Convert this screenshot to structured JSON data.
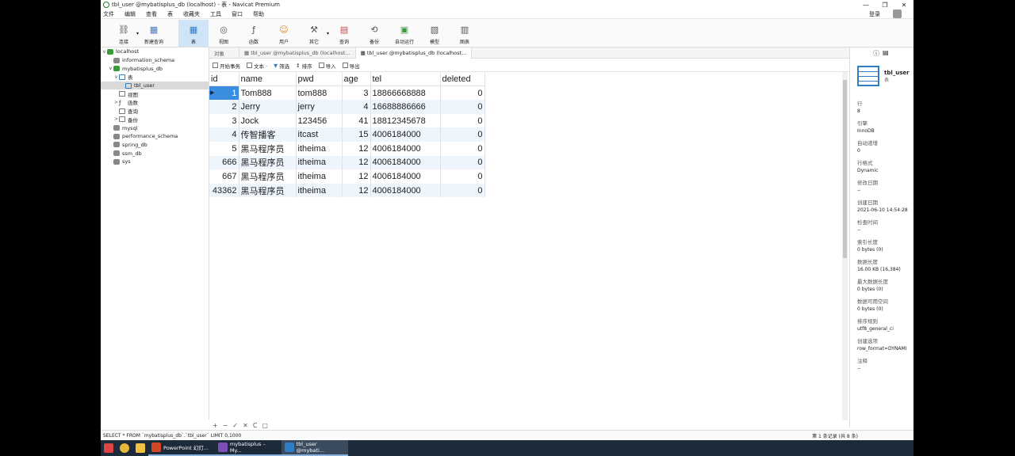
{
  "window": {
    "title": "tbl_user @mybatisplus_db (localhost) - 表 - Navicat Premium",
    "min": "—",
    "max": "❐",
    "close": "✕"
  },
  "menu": [
    "文件",
    "编辑",
    "查看",
    "表",
    "收藏夹",
    "工具",
    "窗口",
    "帮助"
  ],
  "login": "登录",
  "toolbar": [
    {
      "label": "连接",
      "icon": "⛓"
    },
    {
      "label": "新建查询",
      "icon": "▦"
    },
    {
      "label": "表",
      "icon": "▦"
    },
    {
      "label": "视图",
      "icon": "◎"
    },
    {
      "label": "函数",
      "icon": "ƒ"
    },
    {
      "label": "用户",
      "icon": "☺"
    },
    {
      "label": "其它",
      "icon": "⚒"
    },
    {
      "label": "查询",
      "icon": "▤"
    },
    {
      "label": "备份",
      "icon": "⟲"
    },
    {
      "label": "自动运行",
      "icon": "▣"
    },
    {
      "label": "模型",
      "icon": "▧"
    },
    {
      "label": "图表",
      "icon": "▥"
    }
  ],
  "nav": [
    {
      "label": "localhost",
      "level": 0,
      "tw": "∨"
    },
    {
      "label": "information_schema",
      "level": 1,
      "tw": ""
    },
    {
      "label": "mybatisplus_db",
      "level": 1,
      "tw": "∨"
    },
    {
      "label": "表",
      "level": 2,
      "tw": "∨"
    },
    {
      "label": "tbl_user",
      "level": 3,
      "tw": ""
    },
    {
      "label": "视图",
      "level": 2,
      "tw": ""
    },
    {
      "label": "函数",
      "level": 2,
      "tw": ">"
    },
    {
      "label": "查询",
      "level": 2,
      "tw": ""
    },
    {
      "label": "备份",
      "level": 2,
      "tw": ">"
    },
    {
      "label": "mysql",
      "level": 1,
      "tw": ""
    },
    {
      "label": "performance_schema",
      "level": 1,
      "tw": ""
    },
    {
      "label": "spring_db",
      "level": 1,
      "tw": ""
    },
    {
      "label": "ssm_db",
      "level": 1,
      "tw": ""
    },
    {
      "label": "sys",
      "level": 1,
      "tw": ""
    }
  ],
  "tabs": [
    "对象",
    "tbl_user @mybatisplus_db (localhost...",
    "tbl_user @mybatisplus_db (localhost..."
  ],
  "actions": [
    "开始事务",
    "文本 ·",
    "筛选",
    "排序",
    "导入",
    "导出"
  ],
  "columns": [
    "id",
    "name",
    "pwd",
    "age",
    "tel",
    "deleted"
  ],
  "rows": [
    [
      "1",
      "Tom888",
      "tom888",
      "3",
      "18866668888",
      "0"
    ],
    [
      "2",
      "Jerry",
      "jerry",
      "4",
      "16688886666",
      "0"
    ],
    [
      "3",
      "Jock",
      "123456",
      "41",
      "18812345678",
      "0"
    ],
    [
      "4",
      "传智播客",
      "itcast",
      "15",
      "4006184000",
      "0"
    ],
    [
      "5",
      "黑马程序员",
      "itheima",
      "12",
      "4006184000",
      "0"
    ],
    [
      "666",
      "黑马程序员",
      "itheima",
      "12",
      "4006184000",
      "0"
    ],
    [
      "667",
      "黑马程序员",
      "itheima",
      "12",
      "4006184000",
      "0"
    ],
    [
      "43362",
      "黑马程序员",
      "itheima",
      "12",
      "4006184000",
      "0"
    ]
  ],
  "info": {
    "name": "tbl_user",
    "sub": "表",
    "props": [
      {
        "k": "行",
        "v": "8"
      },
      {
        "k": "引擎",
        "v": "InnoDB"
      },
      {
        "k": "自动递增",
        "v": "0"
      },
      {
        "k": "行格式",
        "v": "Dynamic"
      },
      {
        "k": "修改日期",
        "v": "--"
      },
      {
        "k": "创建日期",
        "v": "2021-06-10 14:54:28"
      },
      {
        "k": "检查时间",
        "v": "--"
      },
      {
        "k": "索引长度",
        "v": "0 bytes (0)"
      },
      {
        "k": "数据长度",
        "v": "16.00 KB (16,384)"
      },
      {
        "k": "最大数据长度",
        "v": "0 bytes (0)"
      },
      {
        "k": "数据可用空间",
        "v": "0 bytes (0)"
      },
      {
        "k": "排序规则",
        "v": "utf8_general_ci"
      },
      {
        "k": "创建选项",
        "v": "row_format=DYNAMI"
      },
      {
        "k": "注释",
        "v": "--"
      }
    ]
  },
  "bottom_controls": [
    "+",
    "−",
    "✓",
    "✕",
    "C",
    "▢"
  ],
  "status": {
    "sql": "SELECT * FROM `mybatisplus_db`.`tbl_user` LIMIT 0,1000",
    "right": "第 1 条记录 (共 8 条)"
  },
  "taskbar": [
    {
      "label": "",
      "color": "#d44"
    },
    {
      "label": "",
      "color": "#e8b83a"
    },
    {
      "label": "",
      "color": "#f0c040"
    },
    {
      "label": "PowerPoint 幻灯...",
      "color": "#d24726"
    },
    {
      "label": "mybatisplus – My...",
      "color": "#7b4fb5"
    },
    {
      "label": "tbl_user @mybati...",
      "color": "#2f7dc4"
    }
  ]
}
